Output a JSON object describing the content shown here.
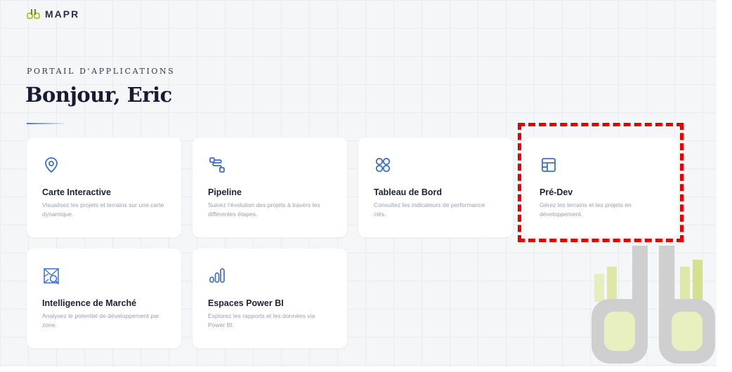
{
  "brand": {
    "name": "MAPR"
  },
  "header": {
    "eyebrow": "PORTAIL D'APPLICATIONS",
    "greeting": "Bonjour, Eric"
  },
  "apps": [
    {
      "title": "Carte Interactive",
      "description": "Visualisez les projets et terrains sur une carte dynamique.",
      "icon": "map-pin-icon"
    },
    {
      "title": "Pipeline",
      "description": "Suivez l'évolution des projets à travers les différentes étapes.",
      "icon": "route-icon"
    },
    {
      "title": "Tableau de Bord",
      "description": "Consultez les indicateurs de performance clés.",
      "icon": "dashboard-grid-icon"
    },
    {
      "title": "Pré-Dev",
      "description": "Gérez les terrains et les projets en développement.",
      "icon": "layout-panel-icon"
    },
    {
      "title": "Intelligence de Marché",
      "description": "Analysez le potentiel de développement par zone.",
      "icon": "market-search-icon"
    },
    {
      "title": "Espaces Power BI",
      "description": "Explorez les rapports et les données via Power BI.",
      "icon": "bar-chart-icon"
    }
  ],
  "colors": {
    "accent": "#3d6fd0",
    "highlight": "#e60000",
    "logo_dark": "#2f6f2a",
    "logo_light": "#a9c94a"
  }
}
